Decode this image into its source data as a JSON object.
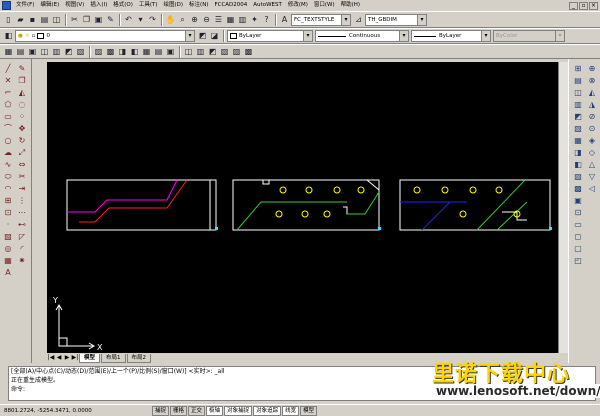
{
  "menu": {
    "items": [
      "文件(F)",
      "编辑(E)",
      "视图(V)",
      "插入(I)",
      "格式(O)",
      "工具(T)",
      "绘图(D)",
      "标注(N)",
      "FCCAD2004",
      "AutoWEST",
      "修改(M)",
      "窗口(W)",
      "帮助(H)"
    ]
  },
  "toolbar1": {
    "text_style": "FC_TEXTSTYLE",
    "dim_style": "TH_GBDIM"
  },
  "toolbar2": {
    "layer": "0",
    "color": "ByLayer",
    "linetype": "Continuous",
    "lineweight": "ByLayer",
    "plotstyle": "ByColor"
  },
  "layout_tabs": [
    "模型",
    "布局1",
    "布局2"
  ],
  "ucs": {
    "y_label": "Y",
    "x_label": "X"
  },
  "command": {
    "line1": "[全部(A)/中心点(C)/动态(D)/范围(E)/上一个(P)/比例(S)/窗口(W)] <实时>: _all",
    "line2": "正在重生成模型。",
    "prompt": "命令:"
  },
  "status": {
    "coords": "8801.2724,  -5254.3471,  0.0000",
    "toggles": [
      "捕捉",
      "栅格",
      "正交",
      "极轴",
      "对象捕捉",
      "对象追踪",
      "线宽",
      "模型"
    ]
  },
  "watermark": {
    "cn": "里诺下载中心",
    "url": "www.lenosoft.net/down/"
  },
  "colors": {
    "canvas": "#000000",
    "frame": "#ffffff",
    "magenta": "#ff00ff",
    "red": "#ff2020",
    "green": "#33cc33",
    "yellow": "#ffff00",
    "blue": "#2020ff",
    "cyan": "#00ffff"
  }
}
